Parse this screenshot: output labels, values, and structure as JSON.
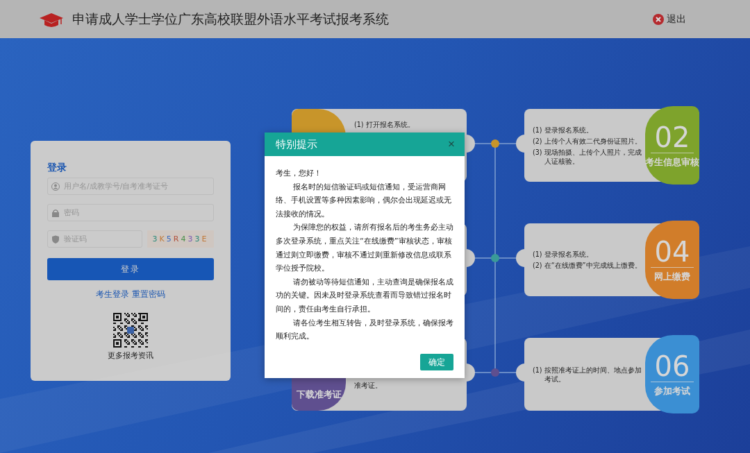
{
  "header": {
    "title": "申请成人学士学位广东高校联盟外语水平考试报考系统",
    "logout": "退出"
  },
  "login": {
    "title": "登录",
    "fields": [
      {
        "kind": "user",
        "placeholder": "用户名/成教学号/自考准考证号"
      },
      {
        "kind": "password",
        "placeholder": "密码"
      },
      {
        "kind": "captcha",
        "placeholder": "验证码"
      }
    ],
    "captcha_text": "3K5R433E",
    "button": "登录",
    "links": [
      "考生登录",
      "重置密码"
    ],
    "qr_caption": "更多报考资讯"
  },
  "left_steps": [
    {
      "color": "#c8952a",
      "lines": [
        "(1) 打开报名系统。"
      ]
    },
    {
      "color": "#3a9a98"
    },
    {
      "color": "#5f4f8f",
      "label": "下载准考证",
      "lines": [
        "准考证。"
      ]
    }
  ],
  "right_steps": [
    {
      "color": "#7ea32c",
      "number": "02",
      "label": "考生信息审核",
      "lines": [
        "(1) 登录报名系统。",
        "(2) 上传个人有效二代身份证照片。",
        "(3) 现场拍摄、上传个人照片，完成人证核验。"
      ]
    },
    {
      "color": "#d17d2a",
      "number": "04",
      "label": "网上缴费",
      "lines": [
        "(1) 登录报名系统。",
        "(2) 在“在线缴费”中完成线上缴费。"
      ]
    },
    {
      "color": "#3b8fd3",
      "number": "06",
      "label": "参加考试",
      "lines": [
        "(1) 按照准考证上的时间、地点参加考试。"
      ]
    }
  ],
  "dialog": {
    "title": "特别提示",
    "close": "×",
    "paragraphs": [
      "考生，您好！",
      "报名时的短信验证码或短信通知，受运营商网络、手机设置等多种因素影响，偶尔会出现延迟或无法接收的情况。",
      "为保障您的权益，请所有报名后的考生务必主动多次登录系统，重点关注“在线缴费”审核状态，审核通过则立即缴费，审核不通过则重新修改信息或联系学位授予院校。",
      "请勿被动等待短信通知，主动查询是确保报名成功的关键。因未及时登录系统查看而导致错过报名时间的，责任由考生自行承担。",
      "请各位考生相互转告，及时登录系统，确保报考顺利完成。"
    ],
    "button": "确定"
  }
}
